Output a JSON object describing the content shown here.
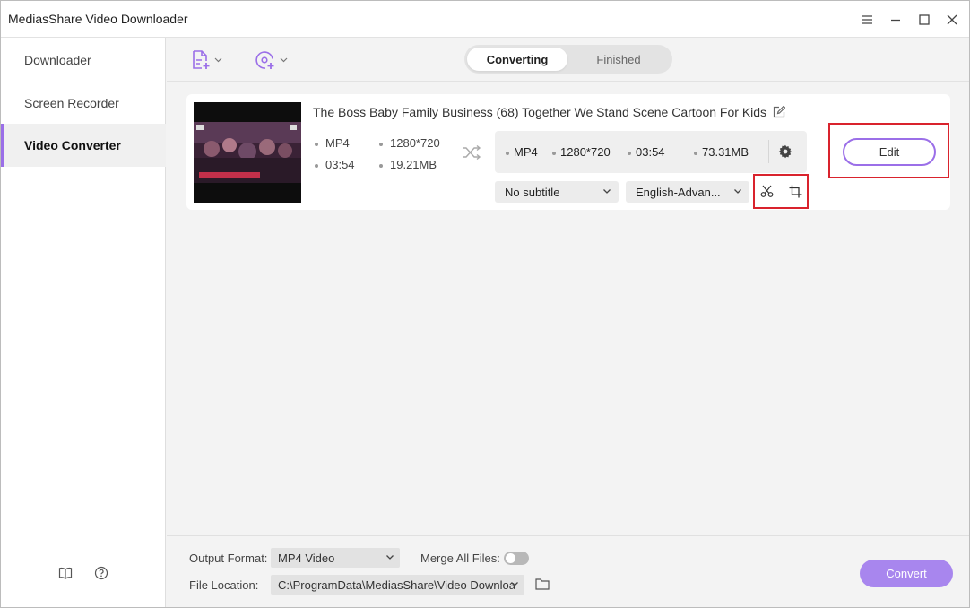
{
  "window": {
    "title": "MediasShare Video Downloader"
  },
  "sidebar": {
    "items": [
      {
        "label": "Downloader",
        "active": false
      },
      {
        "label": "Screen Recorder",
        "active": false
      },
      {
        "label": "Video Converter",
        "active": true
      }
    ],
    "footer_icons": [
      "book-icon",
      "help-icon"
    ]
  },
  "toolbar": {
    "add_file_icon": "add-file-icon",
    "add_disc_icon": "add-disc-icon",
    "tabs": [
      {
        "label": "Converting",
        "active": true
      },
      {
        "label": "Finished",
        "active": false
      }
    ]
  },
  "file": {
    "title": "The Boss Baby Family Business (68)  Together We Stand Scene  Cartoon For Kids",
    "source": {
      "format": "MP4",
      "resolution": "1280*720",
      "duration": "03:54",
      "size": "19.21MB"
    },
    "target": {
      "format": "MP4",
      "resolution": "1280*720",
      "duration": "03:54",
      "size": "73.31MB"
    },
    "subtitle": "No subtitle",
    "audio": "English-Advan...",
    "edit_label": "Edit"
  },
  "bottom": {
    "output_format_label": "Output Format:",
    "output_format_value": "MP4 Video",
    "merge_label": "Merge All Files:",
    "merge_on": false,
    "file_location_label": "File Location:",
    "file_location_value": "C:\\ProgramData\\MediasShare\\Video Downloa",
    "convert_label": "Convert"
  },
  "colors": {
    "accent": "#9b6fe8",
    "convert_button": "#a886ee",
    "highlight": "#d9232d"
  }
}
